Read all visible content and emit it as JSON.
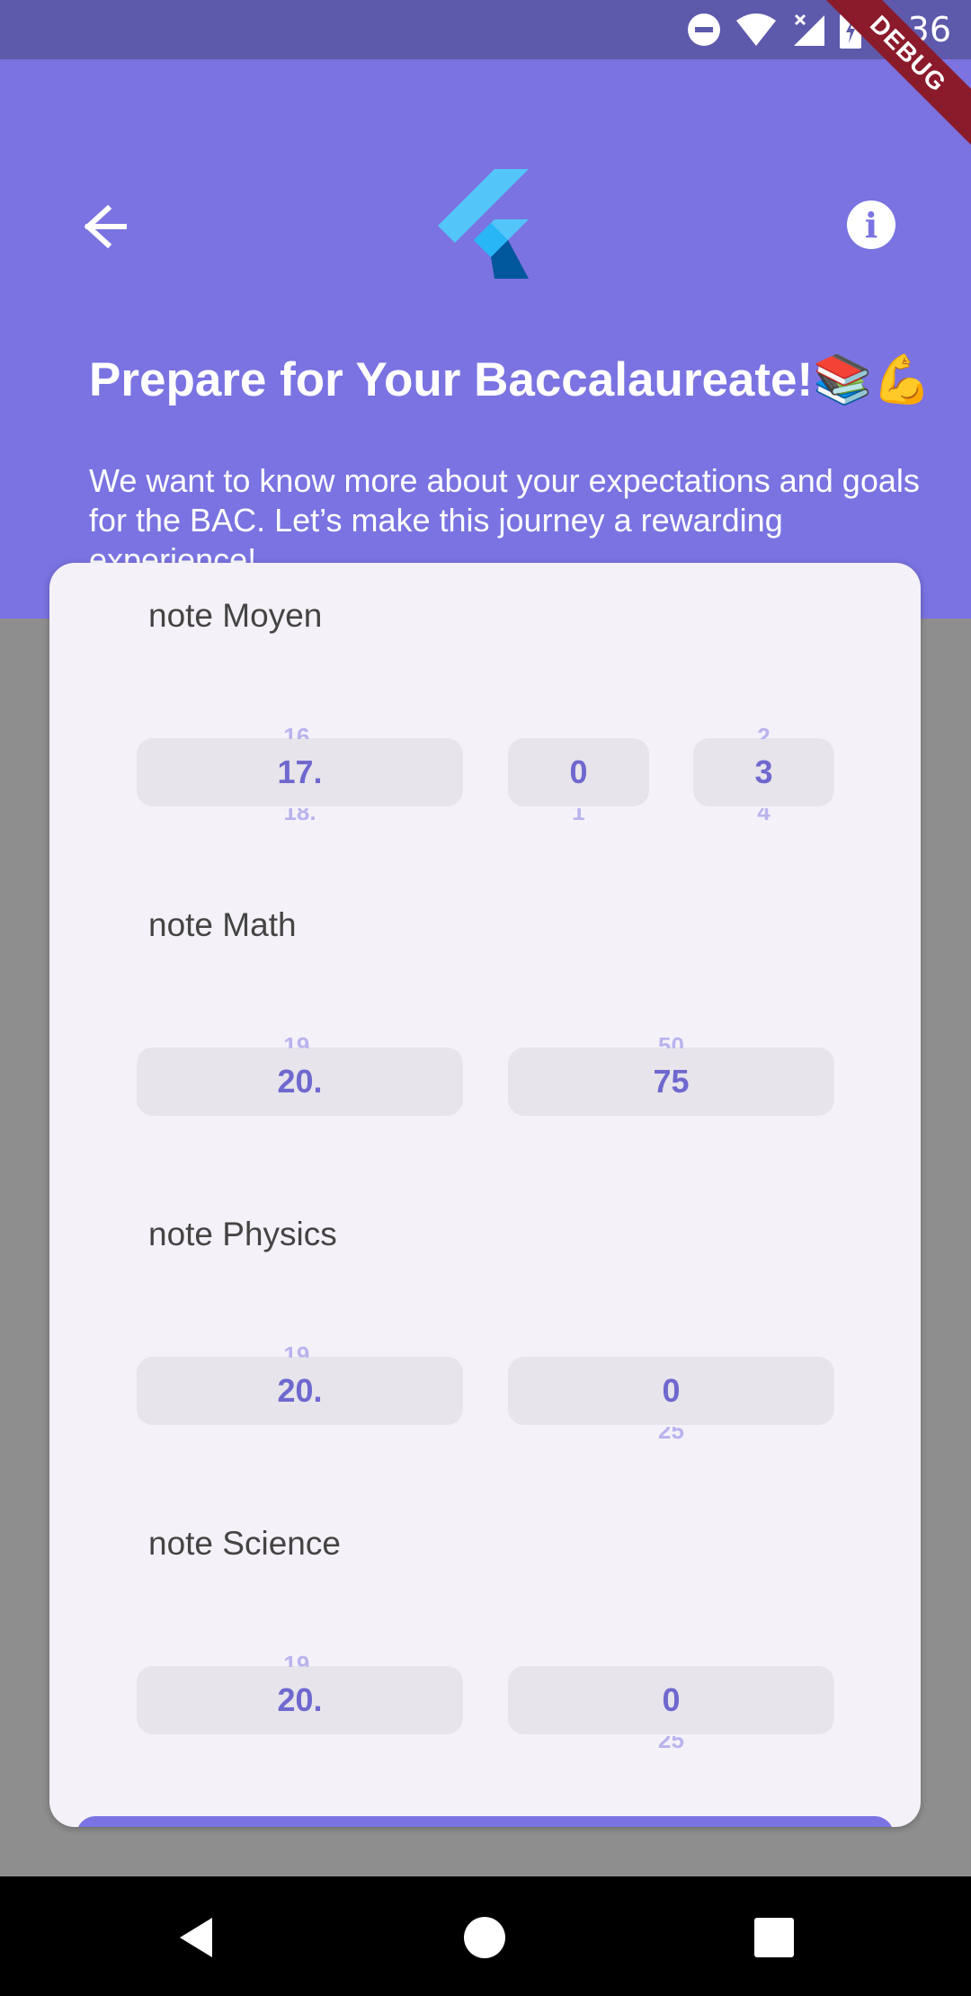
{
  "status_bar": {
    "time": "4:36",
    "debug_label": "DEBUG"
  },
  "header": {
    "title": "Prepare for Your Baccalaureate!📚💪",
    "subtitle": "We want to know more about your expectations and goals for the BAC. Let’s make this journey a rewarding experience!"
  },
  "fields": {
    "moyen": {
      "label": "note Moyen",
      "integer": {
        "prev": "16.",
        "value": "17.",
        "next": "18."
      },
      "decimal1": {
        "prev": "",
        "value": "0",
        "next": "1"
      },
      "decimal2": {
        "prev": "2",
        "value": "3",
        "next": "4"
      }
    },
    "math": {
      "label": "note Math",
      "integer": {
        "prev": "19.",
        "value": "20.",
        "next": ""
      },
      "decimal": {
        "prev": "50",
        "value": "75",
        "next": ""
      }
    },
    "physics": {
      "label": "note Physics",
      "integer": {
        "prev": "19.",
        "value": "20.",
        "next": ""
      },
      "decimal": {
        "prev": "",
        "value": "0",
        "next": "25"
      }
    },
    "science": {
      "label": "note Science",
      "integer": {
        "prev": "19.",
        "value": "20.",
        "next": ""
      },
      "decimal": {
        "prev": "",
        "value": "0",
        "next": "25"
      }
    }
  },
  "colors": {
    "primary": "#7a73e1",
    "status_bar": "#5d59ab",
    "card": "#f5f1f8",
    "picker": "#e7e4eb",
    "scrim": "#8e8e8e"
  },
  "icons": [
    "back-arrow-icon",
    "flutter-logo-icon",
    "info-icon",
    "dnd-icon",
    "wifi-icon",
    "cell-signal-icon",
    "battery-icon",
    "nav-back-icon",
    "nav-home-icon",
    "nav-recents-icon"
  ]
}
